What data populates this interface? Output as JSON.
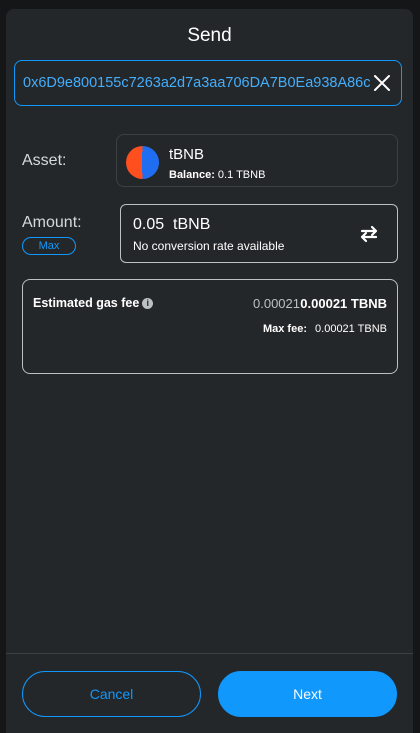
{
  "header": {
    "title": "Send"
  },
  "recipient": {
    "address": "0x6D9e800155c7263a2d7a3aa706DA7B0Ea938A86c"
  },
  "asset": {
    "label": "Asset:",
    "token_symbol": "tBNB",
    "balance_label": "Balance:",
    "balance_value": "0.1 TBNB"
  },
  "amount": {
    "label": "Amount:",
    "max_label": "Max",
    "value": "0.05",
    "unit": "tBNB",
    "conversion_text": "No conversion rate available"
  },
  "gas": {
    "label": "Estimated gas fee",
    "info_icon": "i",
    "fiat_value": "0.00021",
    "native_value": "0.00021 TBNB",
    "max_fee_label": "Max fee:",
    "max_fee_value": "0.00021 TBNB"
  },
  "footer": {
    "cancel_label": "Cancel",
    "next_label": "Next"
  },
  "colors": {
    "accent": "#1098fc",
    "background": "#24272a",
    "outer_background": "#141618"
  },
  "icons": {
    "close": "close-icon",
    "swap": "swap-icon",
    "info": "info-icon",
    "token": "tbnb-token-icon"
  }
}
